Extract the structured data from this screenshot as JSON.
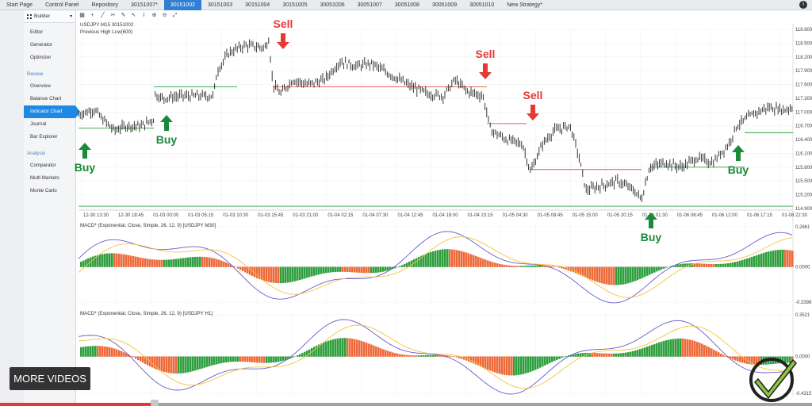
{
  "tabs": [
    "Start Page",
    "Control Panel",
    "Repository",
    "30151007*",
    "30151002",
    "30151003",
    "30151004",
    "30151005",
    "30051006",
    "30051007",
    "30051008",
    "30051009",
    "30051010",
    "New Strategy*"
  ],
  "active_tab": 4,
  "sidebar": {
    "builder_label": "Builder",
    "items_top": [
      "Editor",
      "Generator",
      "Optimizer"
    ],
    "review_label": "Review",
    "review_items": [
      "Overview",
      "Balance Chart",
      "Indicator Chart",
      "Journal",
      "Bar Explorer"
    ],
    "active_review_item": 2,
    "analysis_label": "Analysis",
    "analysis_items": [
      "Comparator",
      "Multi Markets",
      "Monte Carlo"
    ]
  },
  "toolbar": {
    "icons": [
      "grid-icon",
      "plus-icon",
      "line-icon",
      "scissors-icon",
      "draw-icon",
      "pointer-icon",
      "info-icon",
      "zoom-in-icon",
      "zoom-out-icon",
      "fit-icon"
    ]
  },
  "main_chart": {
    "title_line1": "USDJPY  M15 30151002",
    "title_line2": "Previous High Low(600)",
    "y_ticks": [
      "118.800",
      "118.500",
      "118.200",
      "117.900",
      "117.600",
      "117.300",
      "117.000",
      "116.700",
      "116.400",
      "116.100",
      "115.800",
      "115.500",
      "115.200",
      "114.900"
    ],
    "x_ticks": [
      "12-30 13:30",
      "12-30 18:45",
      "01-03 00:00",
      "01-03 05:15",
      "01-03 10:30",
      "01-03 15:45",
      "01-03 21:00",
      "01-04 02:15",
      "01-04 07:30",
      "01-04 12:45",
      "01-04 18:00",
      "01-04 23:15",
      "01-05 04:30",
      "01-05 09:45",
      "01-05 15:00",
      "01-05 20:15",
      "01-06 01:30",
      "01-06 06:45",
      "01-06 12:00",
      "01-06 17:15",
      "01-08 22:30"
    ],
    "colors": {
      "price": "#222222",
      "support": "#2e9e3e",
      "resistance": "#e0533d",
      "buy": "#1a8a3a",
      "sell": "#e53935"
    }
  },
  "signals": [
    {
      "type": "buy",
      "label": "Buy"
    },
    {
      "type": "buy",
      "label": "Buy"
    },
    {
      "type": "sell",
      "label": "Sell"
    },
    {
      "type": "sell",
      "label": "Sell"
    },
    {
      "type": "sell",
      "label": "Sell"
    },
    {
      "type": "buy",
      "label": "Buy"
    },
    {
      "type": "buy",
      "label": "Buy"
    }
  ],
  "macd1": {
    "title": "MACD* (Exponential, Close, Simple, 26, 12, 9) [USDJPY M30]",
    "y_ticks": [
      "0.2861",
      "0.0000",
      "-0.3398"
    ]
  },
  "macd2": {
    "title": "MACD* (Exponential, Close, Simple, 26, 12, 9) [USDJPY H1]",
    "y_ticks": [
      "0.3521",
      "0.0000",
      "-0.4315"
    ]
  },
  "more_videos_label": "MORE VIDEOS",
  "playback_progress": 0.19
}
